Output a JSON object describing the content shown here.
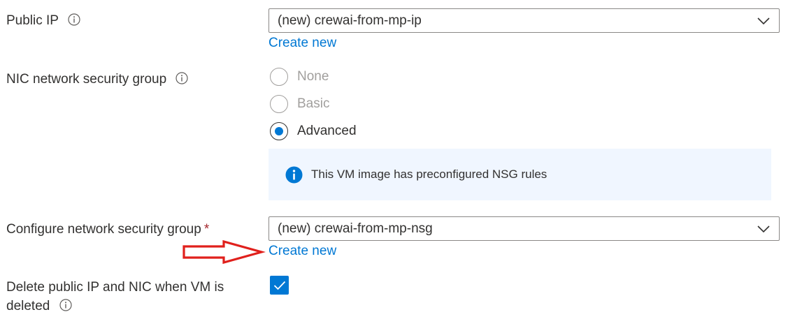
{
  "public_ip": {
    "label": "Public IP",
    "selected_value": "(new) crewai-from-mp-ip",
    "create_new_label": "Create new"
  },
  "nic_nsg": {
    "label": "NIC network security group",
    "options": [
      {
        "label": "None",
        "selected": false,
        "disabled": true
      },
      {
        "label": "Basic",
        "selected": false,
        "disabled": true
      },
      {
        "label": "Advanced",
        "selected": true,
        "disabled": false
      }
    ],
    "info_message": "This VM image has preconfigured NSG rules"
  },
  "configure_nsg": {
    "label": "Configure network security group",
    "required_marker": "*",
    "selected_value": "(new) crewai-from-mp-nsg",
    "create_new_label": "Create new"
  },
  "delete_on_vm_delete": {
    "label_line1": "Delete public IP and NIC when VM is",
    "label_line2": "deleted",
    "checked": true
  },
  "colors": {
    "link": "#0078d4",
    "accent": "#0078d4",
    "required": "#a4262c",
    "info_box_bg": "#f0f6ff",
    "annotation_arrow": "#e0201c"
  },
  "icons": {
    "field_info": "info-circle-outline-icon",
    "dropdown": "chevron-down-icon",
    "message_info": "info-filled-icon",
    "checkmark": "checkmark-icon",
    "annotation": "red-arrow-right-icon"
  }
}
